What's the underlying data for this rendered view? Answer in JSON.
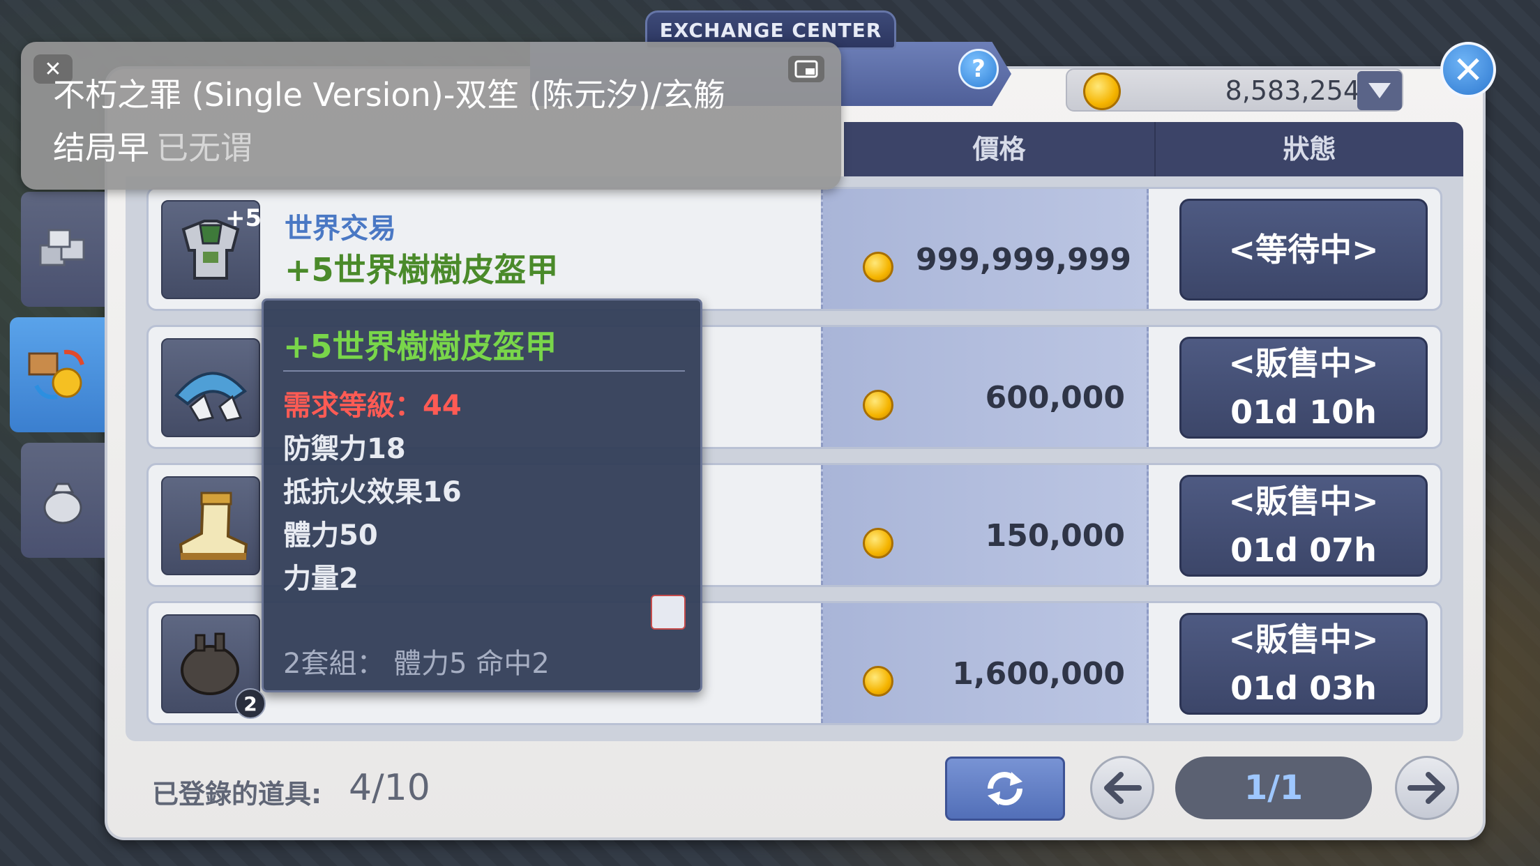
{
  "window": {
    "title": "EXCHANGE CENTER"
  },
  "currency": {
    "value": "8,583,254",
    "icon": "gold-coin-icon"
  },
  "table": {
    "columns": [
      "價格",
      "狀態"
    ],
    "rows": [
      {
        "category": "世界交易",
        "name": "+5世界樹樹皮盔甲",
        "enhance": "+5",
        "price": "999,999,999",
        "status_line1": "<等待中>",
        "status_line2": "",
        "icon": "armor-icon"
      },
      {
        "category": "",
        "name": "",
        "enhance": "",
        "price": "600,000",
        "status_line1": "<販售中>",
        "status_line2": "01d 10h",
        "icon": "hat-icon"
      },
      {
        "category": "",
        "name": "",
        "enhance": "",
        "price": "150,000",
        "status_line1": "<販售中>",
        "status_line2": "01d 07h",
        "icon": "boot-icon"
      },
      {
        "category": "",
        "name": "",
        "enhance": "",
        "price": "1,600,000",
        "status_line1": "<販售中>",
        "status_line2": "01d 03h",
        "icon": "heart-icon",
        "count": "2"
      }
    ]
  },
  "tooltip": {
    "name": "+5世界樹樹皮盔甲",
    "required_level": "需求等級：44",
    "stats": [
      "防禦力18",
      "抵抗火效果16",
      "體力50",
      "力量2"
    ],
    "set_bonus": "2套組： 體力5 命中2"
  },
  "footer": {
    "registered_label": "已登錄的道具:",
    "registered_value": "4/10",
    "page": "1/1"
  },
  "overlay": {
    "line1": "不朽之罪 (Single Version)-双笙 (陈元汐)/玄觞",
    "line2_main": "结局早",
    "line2_dim": "已无谓"
  },
  "colors": {
    "accent_blue": "#4a78c4",
    "item_green": "#4a8a2a",
    "tooltip_green": "#79d64a",
    "requirement_red": "#ff5b54",
    "status_bg": "#4e5a82"
  }
}
